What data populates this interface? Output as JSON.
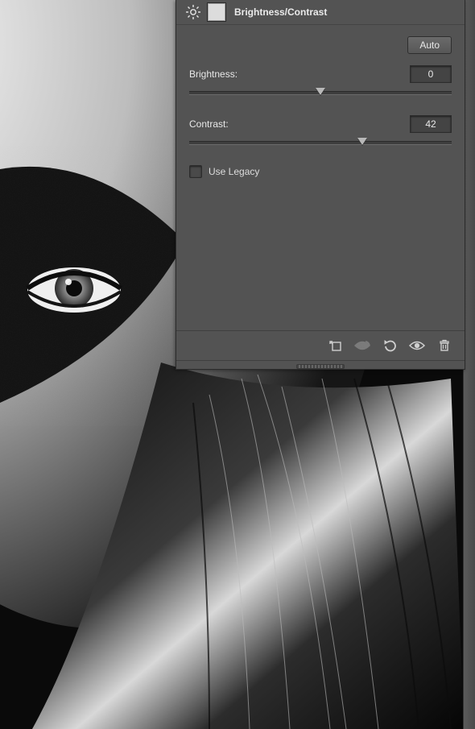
{
  "panel": {
    "title": "Brightness/Contrast",
    "auto_label": "Auto",
    "brightness": {
      "label": "Brightness:",
      "value": "0",
      "min": -150,
      "max": 150,
      "pos_pct": 50
    },
    "contrast": {
      "label": "Contrast:",
      "value": "42",
      "min": -50,
      "max": 100,
      "pos_pct": 66
    },
    "legacy_label": "Use Legacy",
    "legacy_checked": false,
    "footer": {
      "clip": "clip-to-layer-icon",
      "prev": "view-previous-icon",
      "reset": "reset-icon",
      "visibility": "eye-icon",
      "trash": "trash-icon"
    },
    "head_icons": {
      "sun": "brightness-icon",
      "mask": "layer-mask-icon"
    }
  }
}
